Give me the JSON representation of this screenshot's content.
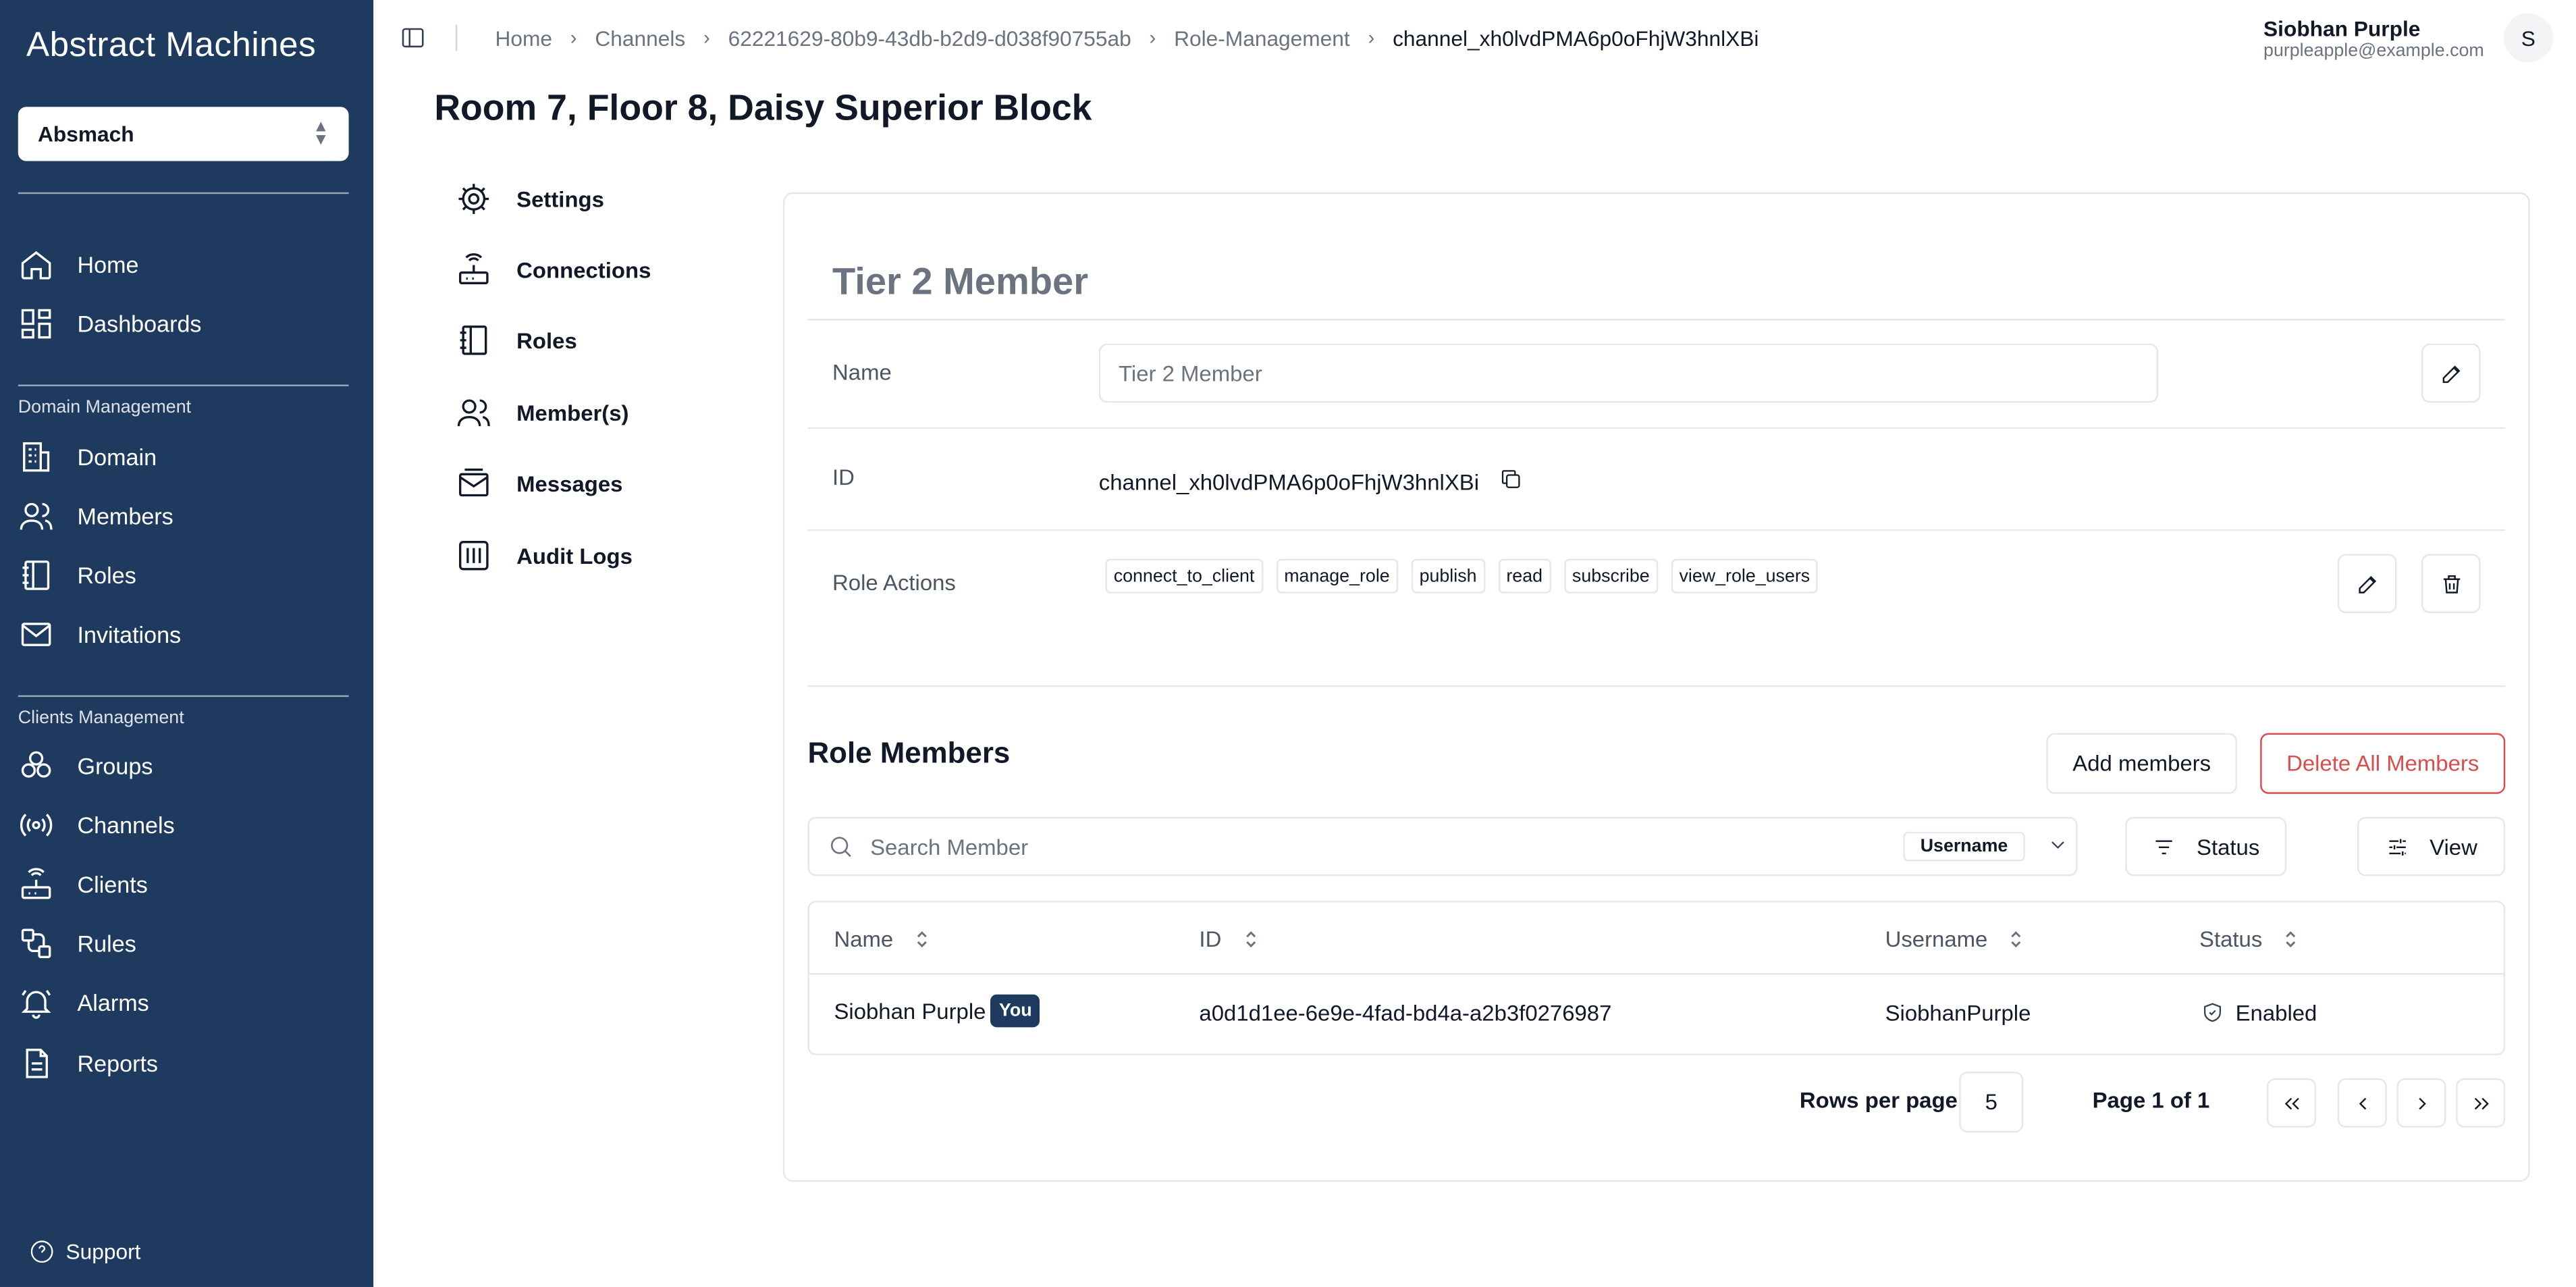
{
  "sidebar": {
    "brand": "Abstract Machines",
    "org_selector": "Absmach",
    "items_top": [
      {
        "label": "Home",
        "icon": "home-icon"
      },
      {
        "label": "Dashboards",
        "icon": "dashboard-icon"
      }
    ],
    "section_domain": "Domain Management",
    "items_domain": [
      {
        "label": "Domain",
        "icon": "domain-icon"
      },
      {
        "label": "Members",
        "icon": "members-icon"
      },
      {
        "label": "Roles",
        "icon": "roles-icon"
      },
      {
        "label": "Invitations",
        "icon": "mail-icon"
      }
    ],
    "section_clients": "Clients Management",
    "items_clients": [
      {
        "label": "Groups",
        "icon": "groups-icon"
      },
      {
        "label": "Channels",
        "icon": "channels-icon"
      },
      {
        "label": "Clients",
        "icon": "clients-icon"
      },
      {
        "label": "Rules",
        "icon": "rules-icon"
      },
      {
        "label": "Alarms",
        "icon": "bell-icon"
      },
      {
        "label": "Reports",
        "icon": "report-icon"
      }
    ],
    "support": "Support"
  },
  "header": {
    "breadcrumb": [
      "Home",
      "Channels",
      "62221629-80b9-43db-b2d9-d038f90755ab",
      "Role-Management",
      "channel_xh0lvdPMA6p0oFhjW3hnlXBi"
    ],
    "user_name": "Siobhan Purple",
    "user_email": "purpleapple@example.com",
    "avatar_initial": "S"
  },
  "page_title": "Room 7, Floor 8, Daisy Superior Block",
  "subnav": [
    {
      "label": "Settings",
      "icon": "gear-icon"
    },
    {
      "label": "Connections",
      "icon": "router-icon"
    },
    {
      "label": "Roles",
      "icon": "roles-icon"
    },
    {
      "label": "Member(s)",
      "icon": "members-icon"
    },
    {
      "label": "Messages",
      "icon": "messages-icon"
    },
    {
      "label": "Audit Logs",
      "icon": "audit-icon"
    }
  ],
  "role": {
    "heading": "Tier 2 Member",
    "name_label": "Name",
    "name_placeholder": "Tier 2 Member",
    "id_label": "ID",
    "id_value": "channel_xh0lvdPMA6p0oFhjW3hnlXBi",
    "actions_label": "Role Actions",
    "actions": [
      "connect_to_client",
      "manage_role",
      "publish",
      "read",
      "subscribe",
      "view_role_users"
    ]
  },
  "members": {
    "title": "Role Members",
    "add_button": "Add members",
    "delete_all_button": "Delete All Members",
    "search_placeholder": "Search Member",
    "search_field": "Username",
    "status_button": "Status",
    "view_button": "View",
    "columns": [
      "Name",
      "ID",
      "Username",
      "Status"
    ],
    "rows": [
      {
        "name": "Siobhan Purple",
        "badge": "You",
        "id": "a0d1d1ee-6e9e-4fad-bd4a-a2b3f0276987",
        "username": "SiobhanPurple",
        "status": "Enabled"
      }
    ],
    "rows_per_page_label": "Rows per page",
    "rows_per_page": "5",
    "page_info": "Page 1 of 1"
  },
  "colors": {
    "sidebar_bg": "#1e3a5f",
    "danger": "#dc4c4c",
    "badge_bg": "#1e3a5f"
  }
}
